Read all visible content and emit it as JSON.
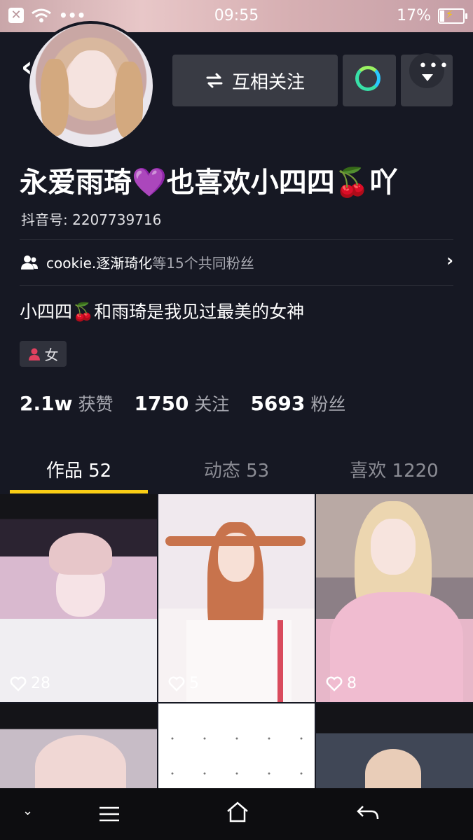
{
  "status_bar": {
    "time": "09:55",
    "battery": "17%"
  },
  "header": {
    "follow_button": "互相关注",
    "display_name": "永爱雨琦💜也喜欢小四四🍒吖",
    "douyin_id": "抖音号: 2207739716"
  },
  "mutual_fans": {
    "username": "cookie.逐渐琦化",
    "text": "等15个共同粉丝"
  },
  "bio": "小四四🍒和雨琦是我见过最美的女神",
  "gender_tag": "女",
  "stats": [
    {
      "value": "2.1w",
      "label": "获赞"
    },
    {
      "value": "1750",
      "label": "关注"
    },
    {
      "value": "5693",
      "label": "粉丝"
    }
  ],
  "tabs": [
    {
      "label": "作品 52",
      "active": true
    },
    {
      "label": "动态 53",
      "active": false
    },
    {
      "label": "喜欢 1220",
      "active": false
    }
  ],
  "videos": [
    {
      "likes": "28"
    },
    {
      "likes": "5"
    },
    {
      "likes": "8"
    }
  ],
  "colors": {
    "background": "#161823",
    "button_bg": "#393b44",
    "accent_underline": "#face15",
    "muted_text": "#a7a8b0"
  },
  "icons": [
    "back-icon",
    "swap-arrows-icon",
    "chat-bubble-icon",
    "more-dots-icon",
    "users-icon",
    "chevron-right-icon",
    "female-user-icon",
    "heart-icon",
    "collapse-icon",
    "menu-icon",
    "home-icon",
    "back-arrow-icon"
  ]
}
